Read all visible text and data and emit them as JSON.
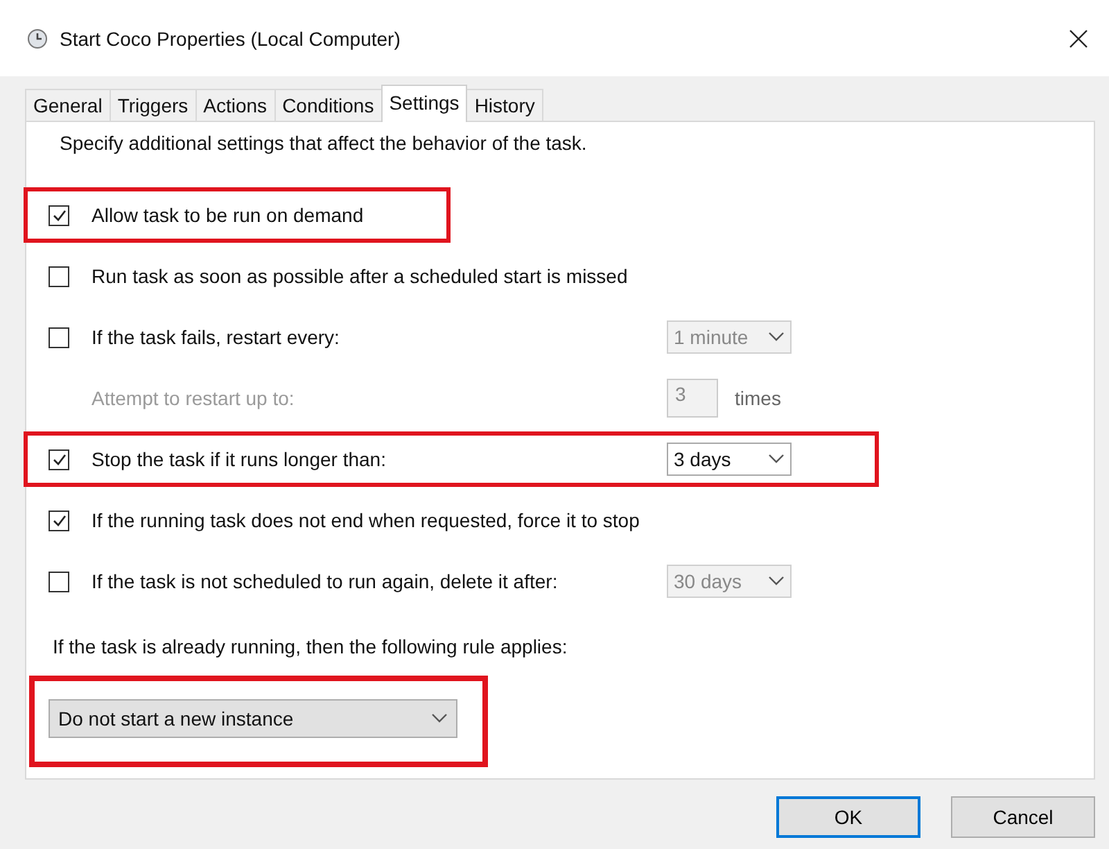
{
  "window": {
    "title": "Start Coco Properties (Local Computer)"
  },
  "tabs": [
    {
      "label": "General",
      "selected": false
    },
    {
      "label": "Triggers",
      "selected": false
    },
    {
      "label": "Actions",
      "selected": false
    },
    {
      "label": "Conditions",
      "selected": false
    },
    {
      "label": "Settings",
      "selected": true
    },
    {
      "label": "History",
      "selected": false
    }
  ],
  "description": "Specify additional settings that affect the behavior of the task.",
  "options": [
    {
      "kind": "checkbox",
      "label": "Allow task to be run on demand",
      "checked": true,
      "highlighted": true
    },
    {
      "kind": "checkbox",
      "label": "Run task as soon as possible after a scheduled start is missed",
      "checked": false,
      "highlighted": false
    },
    {
      "kind": "checkbox",
      "label": "If the task fails, restart every:",
      "checked": false,
      "highlighted": false,
      "dropdown": {
        "value": "1 minute",
        "disabled": true
      }
    },
    {
      "kind": "subfield",
      "label": "Attempt to restart up to:",
      "field": {
        "value": "3"
      },
      "unit": "times"
    },
    {
      "kind": "checkbox",
      "label": "Stop the task if it runs longer than:",
      "checked": true,
      "highlighted": true,
      "dropdown": {
        "value": "3 days",
        "disabled": false
      }
    },
    {
      "kind": "checkbox",
      "label": "If the running task does not end when requested, force it to stop",
      "checked": true,
      "highlighted": false
    },
    {
      "kind": "checkbox",
      "label": "If the task is not scheduled to run again, delete it after:",
      "checked": false,
      "highlighted": false,
      "dropdown": {
        "value": "30 days",
        "disabled": true
      }
    }
  ],
  "rule_label": "If the task is already running, then the following rule applies:",
  "rule_select": {
    "value": "Do not start a new instance",
    "highlighted": true
  },
  "buttons": [
    {
      "label": "OK",
      "default": true
    },
    {
      "label": "Cancel",
      "default": false
    }
  ]
}
